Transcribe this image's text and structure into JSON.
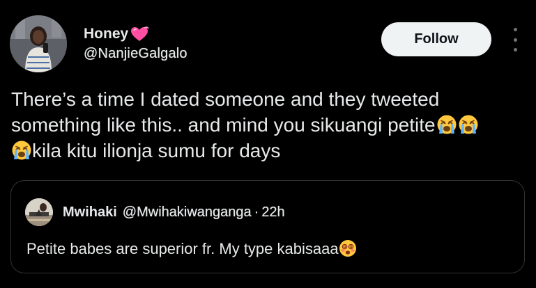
{
  "post": {
    "author": {
      "display_name": "Honey",
      "name_emoji": "heart-with-ribbon-icon",
      "handle": "@NanjieGalgalo"
    },
    "follow_label": "Follow",
    "more_icon": "more-vertical-icon",
    "text": {
      "line1": "There’s a time I dated someone and they tweeted",
      "line2": "something like this.. and mind you sikuangi petite",
      "line3": "kila kitu ilionja sumu for days",
      "emoji": "loudly-crying-face-icon"
    },
    "quoted": {
      "display_name": "Mwihaki",
      "handle": "@Mwihakiwanganga",
      "separator": "·",
      "time": "22h",
      "text": "Petite babes are superior fr. My type kabisaaa",
      "emoji": "face-with-spiral-eyes-icon"
    }
  },
  "colors": {
    "background": "#000000",
    "text": "#e7e9ea",
    "secondary": "#71767b",
    "border": "#2f3336",
    "follow_bg": "#eff3f4",
    "follow_text": "#0f1419",
    "heart": "#ff4fa3"
  }
}
